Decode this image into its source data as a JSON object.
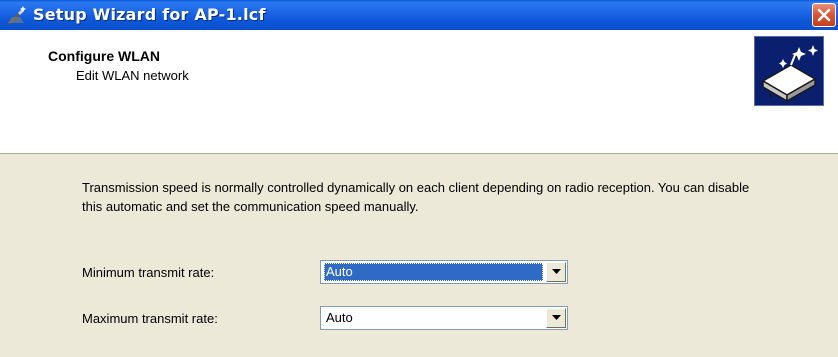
{
  "window": {
    "title": "Setup Wizard for AP-1.lcf",
    "title_icon": "wizard-wand-icon",
    "close_icon": "close-icon"
  },
  "header": {
    "title": "Configure WLAN",
    "subtitle": "Edit WLAN network",
    "graphic_icon": "access-point-sparkle-icon"
  },
  "body": {
    "description": "Transmission speed is normally controlled dynamically on each client depending on radio reception. You can disable this automatic and set the communication speed manually.",
    "fields": [
      {
        "label": "Minimum transmit rate:",
        "value": "Auto",
        "focused": true
      },
      {
        "label": "Maximum transmit rate:",
        "value": "Auto",
        "focused": false
      }
    ]
  },
  "colors": {
    "titlebar": "#0b4fcc",
    "dialog_bg": "#ece9d8",
    "selection": "#316ac5",
    "close_button": "#d8593a"
  }
}
